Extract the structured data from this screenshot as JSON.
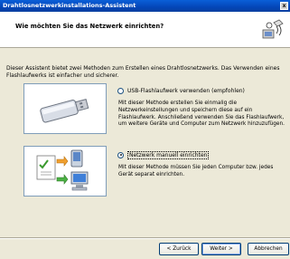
{
  "window": {
    "title": "Drahtlosnetzwerkinstallations-Assistent",
    "close_glyph": "x"
  },
  "header": {
    "title": "Wie möchten Sie das Netzwerk einrichten?",
    "icon": "network-wizard-icon"
  },
  "intro": "Dieser Assistent bietet zwei Methoden zum Erstellen eines Drahtlosnetzwerks. Das Verwenden eines Flashlaufwerks ist einfacher und sicherer.",
  "options": [
    {
      "label": "USB-Flashlaufwerk verwenden (empfohlen)",
      "selected": false,
      "description": "Mit dieser Methode erstellen Sie einmalig die Netzwerkeinstellungen und speichern diese auf ein Flashlaufwerk. Anschließend verwenden Sie das Flashlaufwerk, um weitere Geräte und Computer zum Netzwerk hinzuzufügen.",
      "icon": "usb-drive-icon"
    },
    {
      "label": "Netzwerk manuell einrichten",
      "selected": true,
      "description": "Mit dieser Methode müssen Sie jeden Computer bzw. jedes Gerät separat einrichten.",
      "icon": "manual-network-setup-icon"
    }
  ],
  "buttons": {
    "back": "< Zurück",
    "next": "Weiter >",
    "cancel": "Abbrechen"
  }
}
